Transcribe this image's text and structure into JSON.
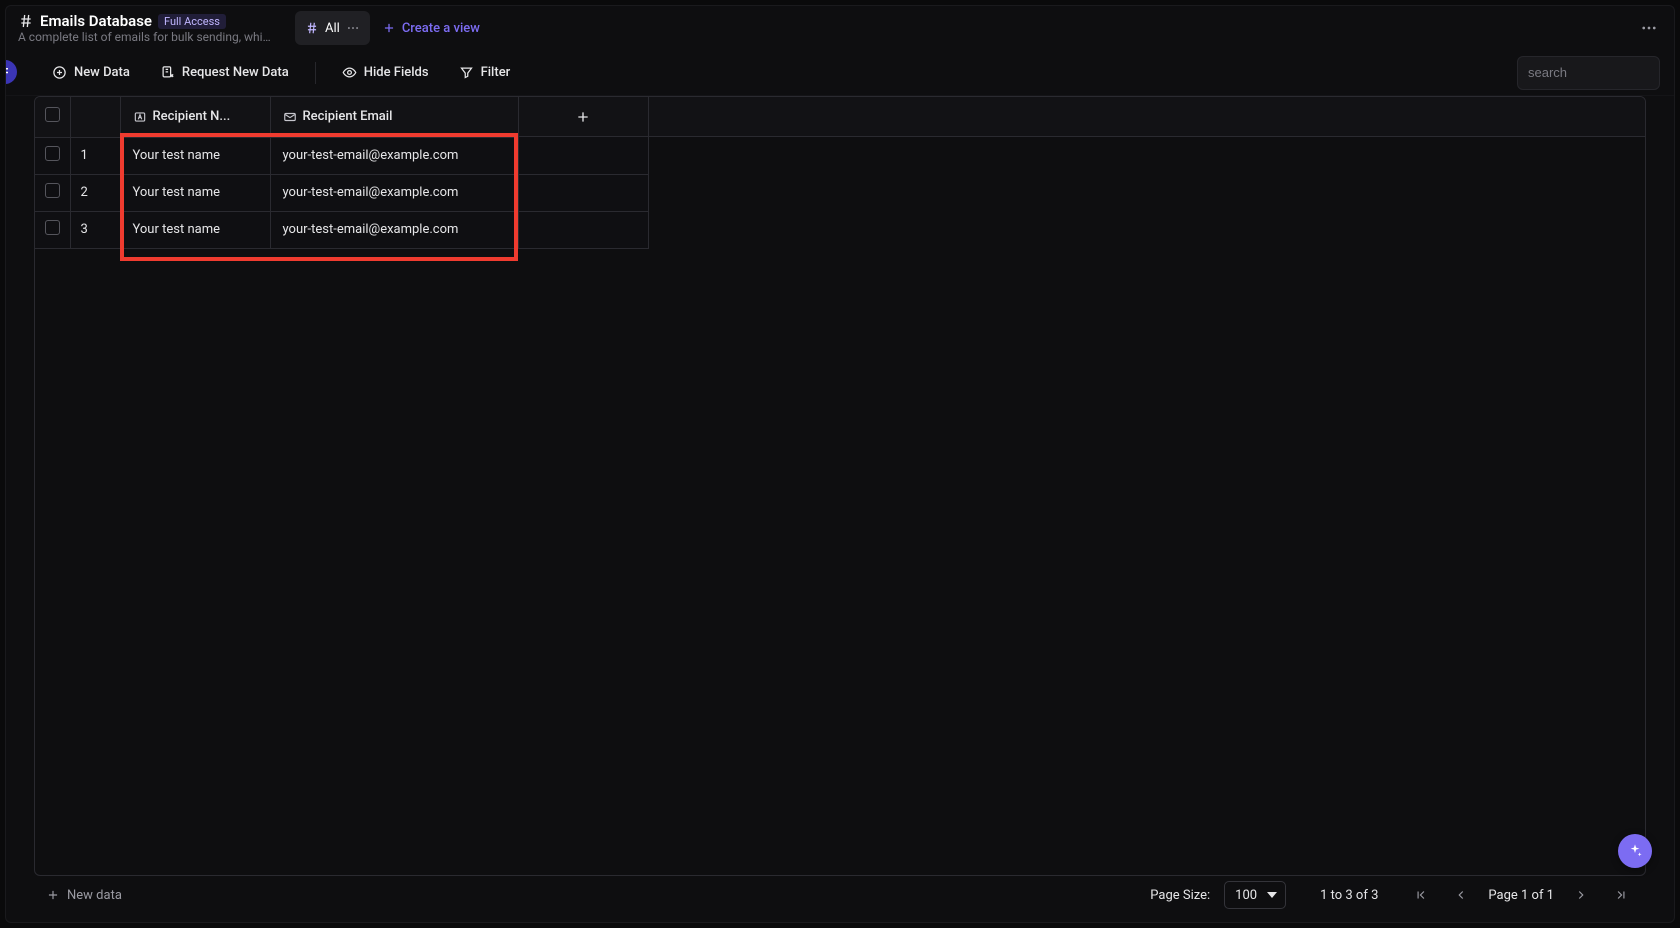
{
  "header": {
    "title": "Emails Database",
    "badge": "Full Access",
    "subtitle": "A complete list of emails for bulk sending, which ca...",
    "activeView": "All",
    "createViewLabel": "Create a view"
  },
  "toolbar": {
    "newData": "New Data",
    "requestNewData": "Request New Data",
    "hideFields": "Hide Fields",
    "filter": "Filter",
    "searchPlaceholder": "search"
  },
  "columns": [
    {
      "key": "name",
      "label": "Recipient N..."
    },
    {
      "key": "email",
      "label": "Recipient Email"
    }
  ],
  "rows": [
    {
      "n": "1",
      "name": "Your test name",
      "email": "your-test-email@example.com"
    },
    {
      "n": "2",
      "name": "Your test name",
      "email": "your-test-email@example.com"
    },
    {
      "n": "3",
      "name": "Your test name",
      "email": "your-test-email@example.com"
    }
  ],
  "footer": {
    "newData": "New data",
    "pageSizeLabel": "Page Size:",
    "pageSizeValue": "100",
    "range": "1 to 3 of 3",
    "pageIndicator": "Page 1 of 1"
  }
}
